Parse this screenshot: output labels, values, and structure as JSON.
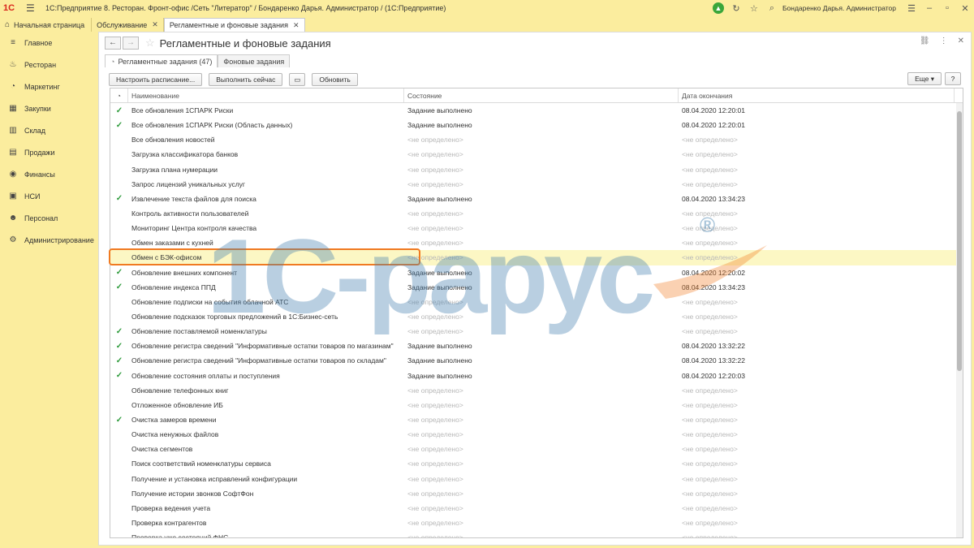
{
  "app": {
    "logo": "1С",
    "title": "1С:Предприятие 8. Ресторан. Фронт-офис /Сеть \"Литератор\" / Бондаренко Дарья. Администратор /  (1С:Предприятие)",
    "user": "Бондаренко Дарья. Администратор"
  },
  "tabs": {
    "home": "Начальная страница",
    "open": [
      "Обслуживание",
      "Регламентные и фоновые задания"
    ]
  },
  "sidebar": {
    "items": [
      {
        "label": "Главное",
        "icon": "list-icon"
      },
      {
        "label": "Ресторан",
        "icon": "chef-icon"
      },
      {
        "label": "Маркетинг",
        "icon": "pie-icon"
      },
      {
        "label": "Закупки",
        "icon": "cart-icon"
      },
      {
        "label": "Склад",
        "icon": "warehouse-icon"
      },
      {
        "label": "Продажи",
        "icon": "sales-icon"
      },
      {
        "label": "Финансы",
        "icon": "finance-icon"
      },
      {
        "label": "НСИ",
        "icon": "reference-icon"
      },
      {
        "label": "Персонал",
        "icon": "person-icon"
      },
      {
        "label": "Администрирование",
        "icon": "gear-icon"
      }
    ]
  },
  "form": {
    "title": "Регламентные и фоновые задания",
    "subtabs": [
      "Регламентные задания (47)",
      "Фоновые задания"
    ],
    "toolbar": {
      "schedule": "Настроить расписание...",
      "run_now": "Выполнить сейчас",
      "refresh": "Обновить",
      "more": "Еще",
      "help": "?"
    },
    "columns": [
      "Наименование",
      "Состояние",
      "Дата окончания"
    ]
  },
  "rows": [
    {
      "check": "✓",
      "name": "Все обновления 1СПАРК Риски",
      "state": "Задание выполнено",
      "date": "08.04.2020 12:20:01"
    },
    {
      "check": "✓",
      "name": "Все обновления 1СПАРК Риски (Область данных)",
      "state": "Задание выполнено",
      "date": "08.04.2020 12:20:01"
    },
    {
      "check": "",
      "name": "Все обновления новостей",
      "state": "<не определено>",
      "date": "<не определено>"
    },
    {
      "check": "",
      "name": "Загрузка классификатора банков",
      "state": "<не определено>",
      "date": "<не определено>"
    },
    {
      "check": "",
      "name": "Загрузка плана нумерации",
      "state": "<не определено>",
      "date": "<не определено>"
    },
    {
      "check": "",
      "name": "Запрос лицензий уникальных услуг",
      "state": "<не определено>",
      "date": "<не определено>"
    },
    {
      "check": "✓",
      "name": "Извлечение текста файлов для поиска",
      "state": "Задание выполнено",
      "date": "08.04.2020 13:34:23"
    },
    {
      "check": "",
      "name": "Контроль активности пользователей",
      "state": "<не определено>",
      "date": "<не определено>"
    },
    {
      "check": "",
      "name": "Мониторинг Центра контроля качества",
      "state": "<не определено>",
      "date": "<не определено>"
    },
    {
      "check": "",
      "name": "Обмен заказами с кухней",
      "state": "<не определено>",
      "date": "<не определено>"
    },
    {
      "check": "",
      "name": "Обмен с БЭК-офисом",
      "state": "<не определено>",
      "date": "<не определено>"
    },
    {
      "check": "✓",
      "name": "Обновление внешних компонент",
      "state": "Задание выполнено",
      "date": "08.04.2020 12:20:02"
    },
    {
      "check": "✓",
      "name": "Обновление индекса ППД",
      "state": "Задание выполнено",
      "date": "08.04.2020 13:34:23"
    },
    {
      "check": "",
      "name": "Обновление подписки на события облачной АТС",
      "state": "<не определено>",
      "date": "<не определено>"
    },
    {
      "check": "",
      "name": "Обновление подсказок торговых предложений в 1С:Бизнес-сеть",
      "state": "<не определено>",
      "date": "<не определено>"
    },
    {
      "check": "✓",
      "name": "Обновление поставляемой номенклатуры",
      "state": "<не определено>",
      "date": "<не определено>"
    },
    {
      "check": "✓",
      "name": "Обновление регистра сведений \"Информативные остатки товаров по магазинам\"",
      "state": "Задание выполнено",
      "date": "08.04.2020 13:32:22"
    },
    {
      "check": "✓",
      "name": "Обновление регистра сведений \"Информативные остатки товаров по складам\"",
      "state": "Задание выполнено",
      "date": "08.04.2020 13:32:22"
    },
    {
      "check": "✓",
      "name": "Обновление состояния оплаты и поступления",
      "state": "Задание выполнено",
      "date": "08.04.2020 12:20:03"
    },
    {
      "check": "",
      "name": "Обновление телефонных книг",
      "state": "<не определено>",
      "date": "<не определено>"
    },
    {
      "check": "",
      "name": "Отложенное обновление ИБ",
      "state": "<не определено>",
      "date": "<не определено>"
    },
    {
      "check": "✓",
      "name": "Очистка замеров времени",
      "state": "<не определено>",
      "date": "<не определено>"
    },
    {
      "check": "",
      "name": "Очистка ненужных файлов",
      "state": "<не определено>",
      "date": "<не определено>"
    },
    {
      "check": "",
      "name": "Очистка сегментов",
      "state": "<не определено>",
      "date": "<не определено>"
    },
    {
      "check": "",
      "name": "Поиск соответствий номенклатуры сервиса",
      "state": "<не определено>",
      "date": "<не определено>"
    },
    {
      "check": "",
      "name": "Получение и установка исправлений конфигурации",
      "state": "<не определено>",
      "date": "<не определено>"
    },
    {
      "check": "",
      "name": "Получение истории звонков СофтФон",
      "state": "<не определено>",
      "date": "<не определено>"
    },
    {
      "check": "",
      "name": "Проверка ведения учета",
      "state": "<не определено>",
      "date": "<не определено>"
    },
    {
      "check": "",
      "name": "Проверка контрагентов",
      "state": "<не определено>",
      "date": "<не определено>"
    },
    {
      "check": "",
      "name": "Проверка уже состояний ФНС",
      "state": "<не определено>",
      "date": "<не определено>"
    }
  ],
  "selected_row": 10,
  "watermark": {
    "text": "1C-рарус",
    "reg": "®"
  },
  "colors": {
    "accent": "#fbed9e",
    "check": "#2e9b3c",
    "highlight": "#f07a21"
  }
}
